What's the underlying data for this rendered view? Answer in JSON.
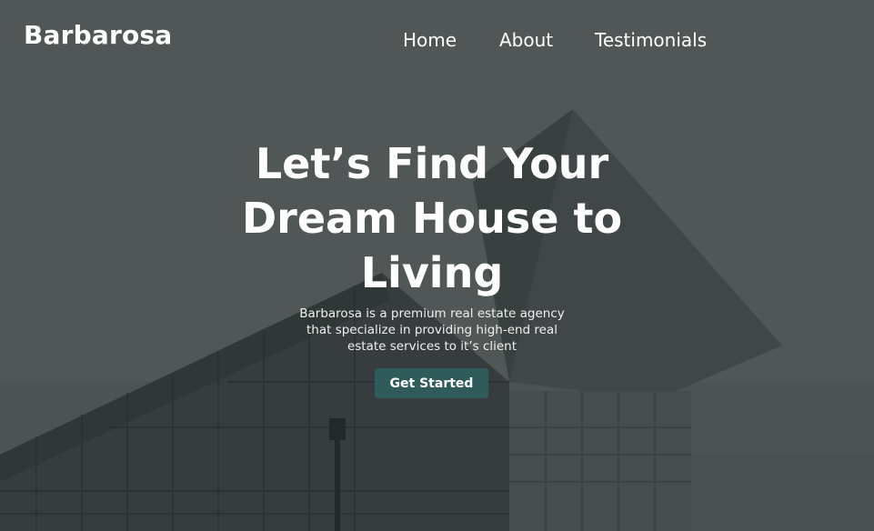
{
  "brand": {
    "name": "Barbarosa"
  },
  "nav": {
    "items": [
      {
        "label": "Home"
      },
      {
        "label": "About"
      },
      {
        "label": "Testimonials"
      }
    ]
  },
  "hero": {
    "headline": "Let’s Find Your Dream House to Living",
    "subtitle": "Barbarosa is a premium real estate agency that specialize in providing high-end real estate services to it’s client",
    "cta_label": "Get Started"
  },
  "colors": {
    "overlay": "#1c2021",
    "cta_background": "#2f5b5a",
    "text": "#ffffff"
  }
}
